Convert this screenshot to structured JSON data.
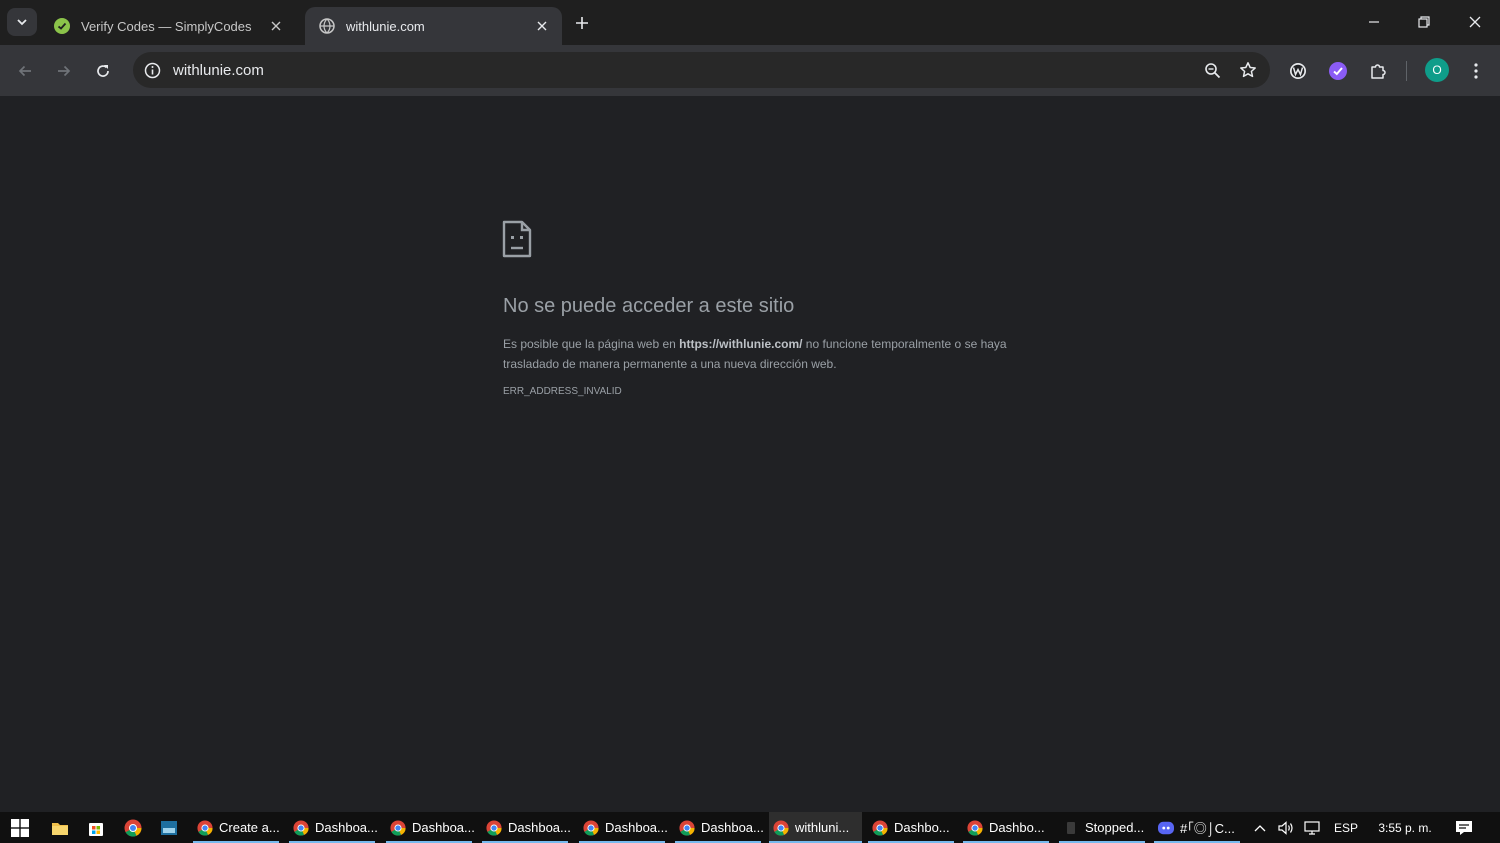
{
  "browser": {
    "tabs": [
      {
        "title": "Verify Codes — SimplyCodes",
        "favicon": "simplycodes-icon",
        "active": false
      },
      {
        "title": "withlunie.com",
        "favicon": "globe-icon",
        "active": true
      }
    ],
    "url": "withlunie.com",
    "avatar_letter": "O"
  },
  "error_page": {
    "title": "No se puede acceder a este sitio",
    "desc_before": "Es posible que la página web en ",
    "desc_url": "https://withlunie.com/",
    "desc_after": " no funcione temporalmente o se haya trasladado de manera permanente a una nueva dirección web.",
    "code": "ERR_ADDRESS_INVALID"
  },
  "taskbar": {
    "apps": [
      {
        "label": "Create a...",
        "icon": "chrome-icon",
        "active": false
      },
      {
        "label": "Dashboa...",
        "icon": "chrome-icon",
        "active": false
      },
      {
        "label": "Dashboa...",
        "icon": "chrome-icon",
        "active": false
      },
      {
        "label": "Dashboa...",
        "icon": "chrome-icon",
        "active": false
      },
      {
        "label": "Dashboa...",
        "icon": "chrome-icon",
        "active": false
      },
      {
        "label": "Dashboa...",
        "icon": "chrome-icon",
        "active": false
      },
      {
        "label": "withluni...",
        "icon": "chrome-icon",
        "active": true
      },
      {
        "label": "Dashbo...",
        "icon": "chrome-icon",
        "active": false
      },
      {
        "label": "Dashbo...",
        "icon": "chrome-icon",
        "active": false
      },
      {
        "label": "Stopped...",
        "icon": "app-icon",
        "active": false
      },
      {
        "label": "#｢◎︎⌡C...",
        "icon": "discord-icon",
        "active": false
      }
    ],
    "language": "ESP",
    "time": "3:55 p. m."
  },
  "colors": {
    "page_bg": "#202124",
    "toolbar_bg": "#35363a",
    "avatar": "#0f9d8a",
    "taskbar_accent": "#76b9ed"
  }
}
